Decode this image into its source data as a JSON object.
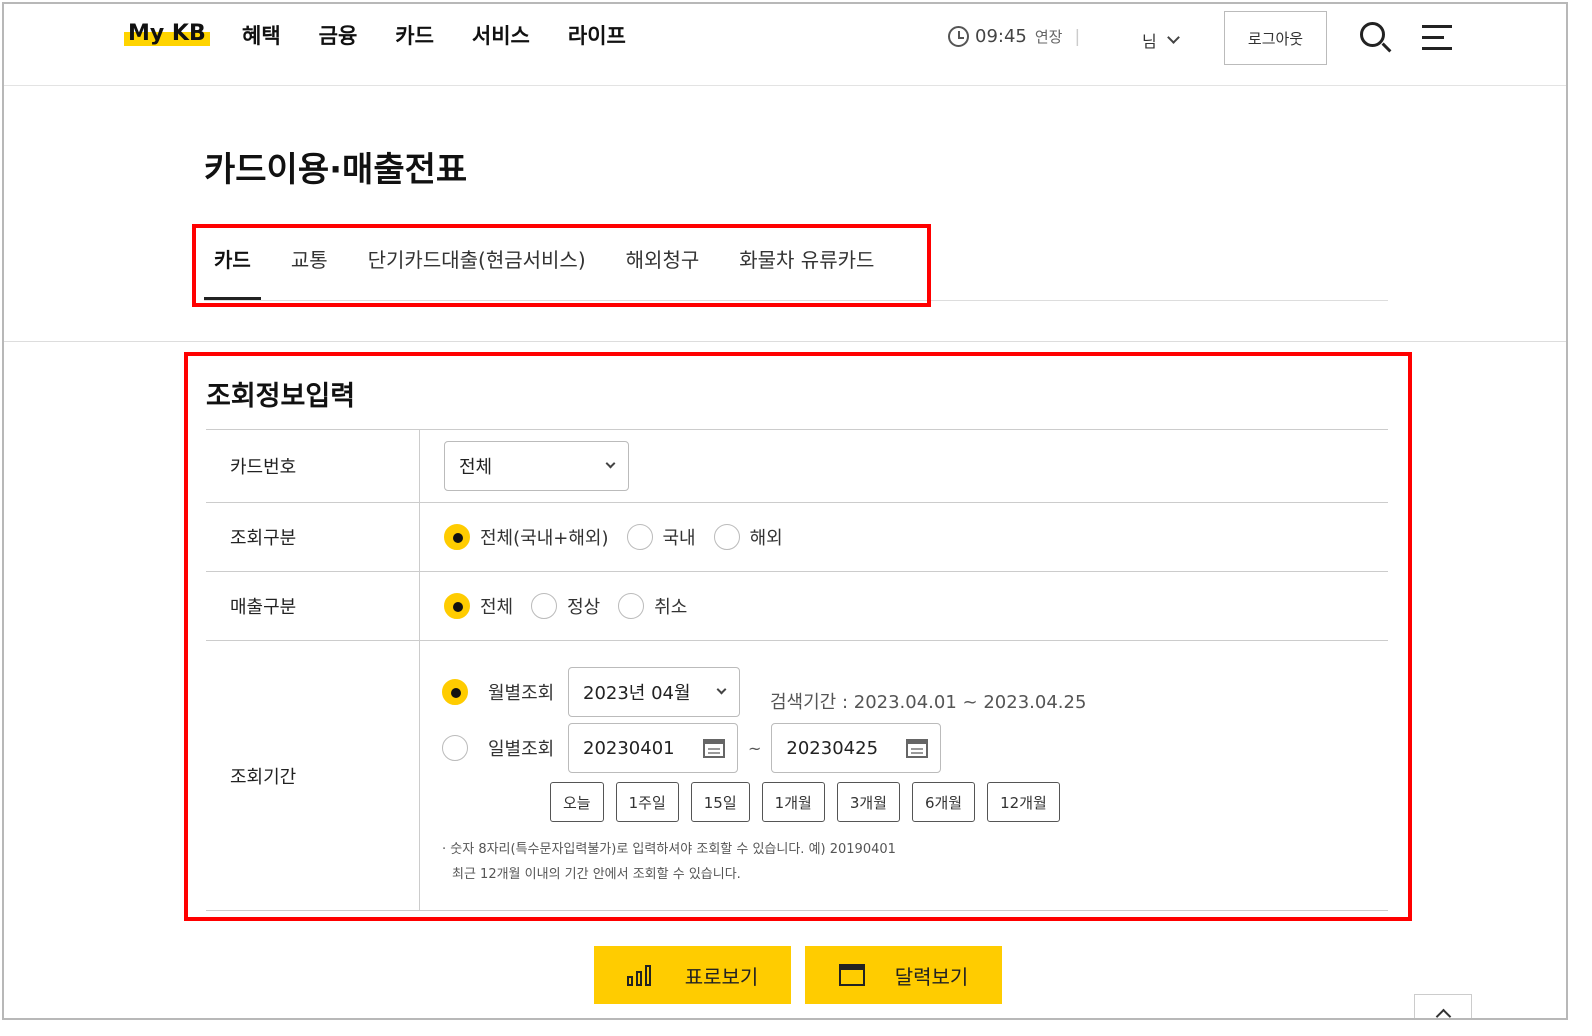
{
  "header": {
    "logo_my": "My",
    "logo_kb": "KB",
    "menu": [
      "혜택",
      "금융",
      "카드",
      "서비스",
      "라이프"
    ],
    "timer": "09:45",
    "extend": "연장",
    "separator": "|",
    "user": "님",
    "logout": "로그아웃"
  },
  "page": {
    "title": "카드이용·매출전표",
    "tabs": [
      "카드",
      "교통",
      "단기카드대출(현금서비스)",
      "해외청구",
      "화물차 유류카드"
    ],
    "active_tab": "카드"
  },
  "form": {
    "title": "조회정보입력",
    "card_no_label": "카드번호",
    "card_no_value": "전체",
    "inquiry_type_label": "조회구분",
    "inquiry_type_options": [
      "전체(국내+해외)",
      "국내",
      "해외"
    ],
    "inquiry_type_selected": "전체(국내+해외)",
    "sales_type_label": "매출구분",
    "sales_type_options": [
      "전체",
      "정상",
      "취소"
    ],
    "sales_type_selected": "전체",
    "period_label": "조회기간",
    "monthly_label": "월별조회",
    "monthly_value": "2023년 04월",
    "search_range": "검색기간 : 2023.04.01 ~ 2023.04.25",
    "daily_label": "일별조회",
    "date_from": "20230401",
    "date_tilde": "~",
    "date_to": "20230425",
    "quick_buttons": [
      "오늘",
      "1주일",
      "15일",
      "1개월",
      "3개월",
      "6개월",
      "12개월"
    ],
    "note_line1": "· 숫자 8자리(특수문자입력불가)로 입력하셔야 조회할 수 있습니다. 예) 20190401",
    "note_line2": "최근 12개월 이내의 기간 안에서 조회할 수 있습니다."
  },
  "actions": {
    "table_view": "표로보기",
    "calendar_view": "달력보기"
  },
  "colors": {
    "accent": "#ffcc00",
    "highlight_box": "#ff0000"
  }
}
